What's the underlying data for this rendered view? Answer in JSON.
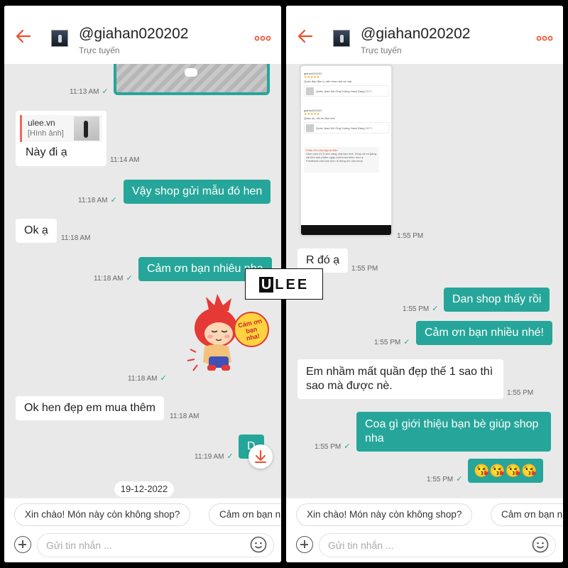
{
  "logo": {
    "initial": "U",
    "rest": "LEE"
  },
  "left": {
    "header": {
      "username": "@giahan020202",
      "status": "Trực tuyến"
    },
    "quote": {
      "site": "ulee.vn",
      "label": "[Hình ảnh]",
      "text": "Này đi ạ"
    },
    "timestamps": {
      "photo": "11:13 AM",
      "quote": "11:14 AM",
      "m1": "11:18 AM",
      "m2": "11:18 AM",
      "m3": "11:18 AM",
      "sticker": "11:18 AM",
      "m4": "11:18 AM",
      "m5": "11:19 AM"
    },
    "messages": {
      "m1": "Vậy shop gửi mẫu đó hen",
      "m2": "Ok ạ",
      "m3": "Cảm ơn bạn nhiêu nha",
      "m4": "Ok hen đẹp em mua thêm",
      "m5": "D"
    },
    "sticker_text": "Cảm ơn bạn nha!",
    "date_chip": "19-12-2022",
    "quick_replies": [
      "Xin chào! Món này còn không shop?",
      "Cảm ơn bạn n"
    ],
    "input_placeholder": "Gửi tin nhắn ..."
  },
  "right": {
    "header": {
      "username": "@giahan020202",
      "status": "Trực tuyến"
    },
    "phone": {
      "rev1_user": "giahan020202",
      "rev1_text": "Quần đẹp lắm ạ, nên mua nhé cả nhà",
      "rev1_product": "Quần Jean Nữ Ống Suông Hack Dáng OJ T...",
      "rev2_user": "giahan020202",
      "rev2_text": "Quần ok, vải ơn lắm nha",
      "rev2_product": "Quần Jean Nữ Ống Suông Hack Dáng OJ T...",
      "reply_title": "Phản Hồi của Người Bán",
      "reply_text": "Ulee cảm ơn 5 sao vàng của bạn nhé. Shop sẽ cố gắng cải tiến sản phẩm ngày một hoàn thiện hơn ạ. Feedback của bạn luôn là động lực của shop"
    },
    "timestamps": {
      "phone": "1:55 PM",
      "m1": "1:55 PM",
      "m2": "1:55 PM",
      "m3": "1:55 PM",
      "m4": "1:55 PM",
      "m5": "1:55 PM",
      "m6": "1:55 PM",
      "m7": "1:55 PM"
    },
    "messages": {
      "m1": "R đó ạ",
      "m2": "Dan shop thấy rồi",
      "m3": "Cảm ơn bạn nhiều nhé!",
      "m4": "Em nhầm mất quần đẹp thế 1 sao thì sao mà được nè.",
      "m5": "Coa gì giới thiệu bạn bè giúp shop nha",
      "m6": "😘😘😘😘"
    },
    "quick_replies": [
      "Xin chào! Món này còn không shop?",
      "Cảm ơn bạn n"
    ],
    "input_placeholder": "Gửi tin nhắn ..."
  },
  "icons": {
    "back": "back-arrow-icon",
    "more": "more-icon",
    "plus": "plus-icon",
    "emoji": "emoji-icon",
    "download": "download-icon",
    "check": "check-icon"
  },
  "colors": {
    "accent": "#ee4d2d",
    "teal": "#26a69a"
  }
}
